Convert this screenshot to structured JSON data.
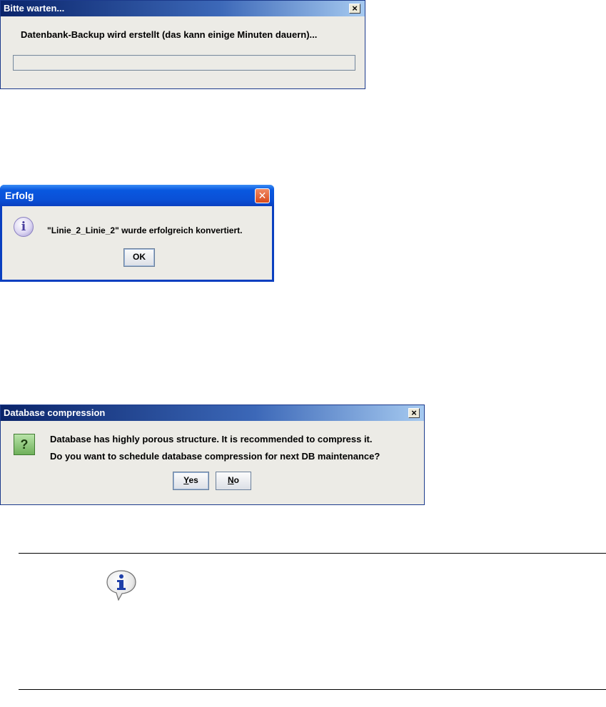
{
  "dialog_wait": {
    "title": "Bitte warten...",
    "close_glyph": "×",
    "message": "Datenbank-Backup wird erstellt (das kann einige Minuten dauern)...",
    "progress": 0
  },
  "dialog_success": {
    "title": "Erfolg",
    "close_glyph": "✕",
    "icon": "info-icon",
    "icon_glyph": "i",
    "message": "\"Linie_2_Linie_2\" wurde erfolgreich konvertiert.",
    "ok_label": "OK"
  },
  "dialog_compress": {
    "title": "Database compression",
    "close_glyph": "×",
    "icon": "question-icon",
    "icon_glyph": "?",
    "message_line1": "Database has highly porous structure. It is recommended to compress it.",
    "message_line2": "Do you want to schedule database compression for next DB maintenance?",
    "yes_mnemonic": "Y",
    "yes_rest": "es",
    "no_mnemonic": "N",
    "no_rest": "o"
  },
  "note": {
    "icon": "info-speech-bubble-icon"
  },
  "colors": {
    "dialog_bg": "#ecebe6",
    "classic_title_dark": "#0a246a",
    "xp_title_blue": "#0a50d6"
  }
}
